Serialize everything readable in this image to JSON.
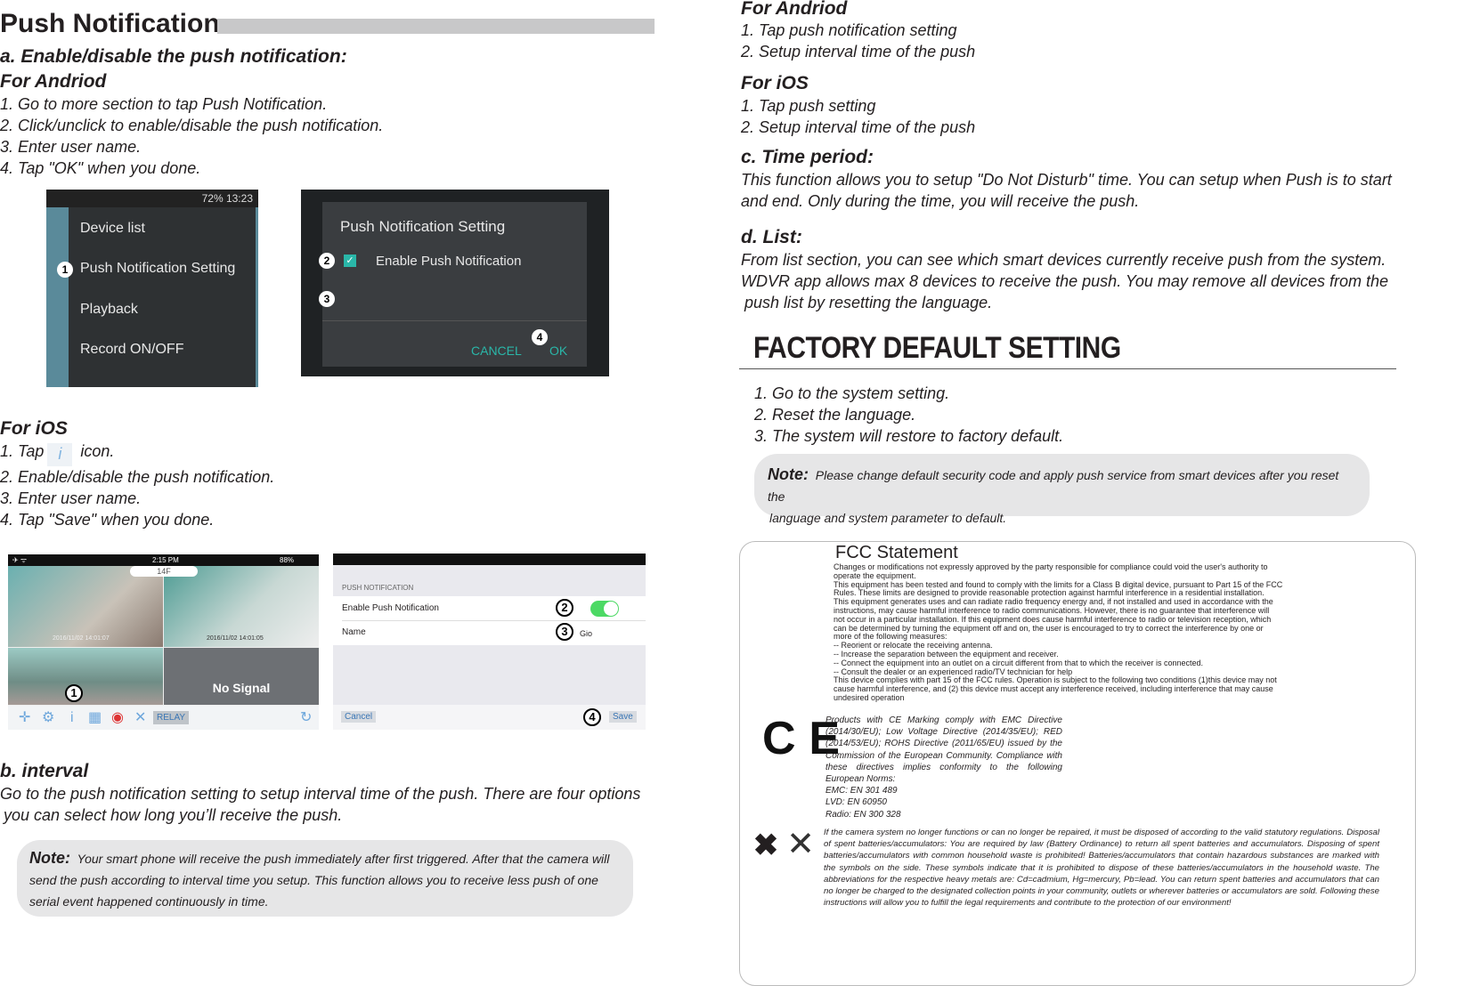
{
  "left": {
    "title": "Push  Notification",
    "section_a": "a. Enable/disable the push notification:",
    "android_heading": "For Andriod",
    "android_steps": [
      "1. Go to more section to tap Push Notification.",
      "2. Click/unclick to enable/disable the push notification.",
      "3. Enter user name.",
      "4. Tap \"OK\" when you done."
    ],
    "android_shot1": {
      "status": "72%  13:23",
      "items": [
        "Device list",
        "Push Notification Setting",
        "Playback",
        "Record ON/OFF"
      ],
      "badge": "1"
    },
    "android_shot2": {
      "title": "Push Notification Setting",
      "checkbox_label": "Enable Push Notification",
      "cancel": "CANCEL",
      "ok": "OK",
      "badges": [
        "2",
        "3",
        "4"
      ]
    },
    "ios_heading": "For iOS",
    "ios_steps": [
      "1. Tap",
      "icon.",
      "2. Enable/disable the push notification.",
      "3. Enter user name.",
      "4. Tap \"Save\" when you done."
    ],
    "ios_shot1": {
      "time": "2:15 PM",
      "battery": "88%",
      "floor": "14F",
      "stamp1": "2016/11/02 14:01:07",
      "stamp2": "2016/11/02 14:01:05",
      "no_signal": "No Signal",
      "relay": "RELAY",
      "badge": "1"
    },
    "ios_shot2": {
      "section": "PUSH NOTIFICATION",
      "enable_label": "Enable Push Notification",
      "toggle_on": true,
      "name_label": "Name",
      "name_value": "Gio",
      "cancel": "Cancel",
      "save": "Save",
      "badges": [
        "2",
        "3",
        "4"
      ]
    },
    "section_b": "b. interval",
    "interval_text": [
      "Go to the push notification setting to setup interval time of the push. There are four options",
      "you can select how long you’ll receive the push."
    ],
    "note_label": "Note:",
    "note_text": [
      "Your smart phone will receive the push immediately after first triggered. After that the camera will",
      "send the push according to interval time you setup. This function allows you to receive less push of one",
      "serial event happened continuously in time."
    ]
  },
  "right": {
    "android_heading": "For Andriod",
    "android_steps": [
      "1. Tap push notification setting",
      "2. Setup interval time of the push"
    ],
    "ios_heading": "For iOS",
    "ios_steps": [
      "1. Tap push setting",
      "2. Setup interval time of the push"
    ],
    "section_c": "c. Time period:",
    "c_text": [
      "This function allows you to setup \"Do Not Disturb\" time. You can setup when Push is to start",
      "and end. Only during the time,  you will receive the push."
    ],
    "section_d": "d. List:",
    "d_text": [
      "From list section, you can see which smart devices currently receive push from the system.",
      "WDVR app allows max 8 devices to receive the push. You may remove all devices from the",
      "push list by resetting the language."
    ],
    "factory_title": "FACTORY DEFAULT SETTING",
    "factory_steps": [
      "1. Go to the system setting.",
      "2. Reset the language.",
      "3. The system will restore to factory default."
    ],
    "note_label": "Note:",
    "note_text": [
      "Please change default security code and apply push service from smart devices after you reset the",
      "language and system parameter to default."
    ],
    "fcc_title": "FCC Statement",
    "fcc_lines": [
      "Changes or modifications not expressly approved by the party responsible for compliance could void the user's authority to",
      "operate the equipment.",
      "This equipment has been tested and found to comply with the limits for a Class B digital device, pursuant to Part 15 of the FCC",
      "Rules. These limits are designed to provide reasonable protection against harmful interference in a residential installation.",
      "This equipment generates uses and can radiate radio frequency energy and, if not installed and used in accordance with the",
      "instructions, may cause harmful interference to radio communications. However, there is no guarantee that interference will",
      "not occur in a particular installation. If this equipment does cause harmful interference to radio or television reception, which",
      "can be determined by turning the equipment off and on, the user is encouraged to try to correct the interference by one or",
      "more of the following measures:",
      "-- Reorient or relocate the receiving antenna.",
      "-- Increase the separation between the equipment and receiver.",
      "-- Connect the equipment into an outlet on a circuit different from that to which the receiver is connected.",
      "-- Consult the dealer or an experienced radio/TV technician for help",
      "This device complies with part 15 of the FCC rules. Operation is subject to the following two conditions (1)this device may not",
      "cause harmful interference, and (2) this device must accept any interference received, including interference that may cause",
      "undesired operation"
    ],
    "ce_logo": "CE",
    "ce_text": "Products with CE Marking comply with EMC Directive (2014/30/EU); Low Voltage Directive (2014/35/EU); RED (2014/53/EU); ROHS Directive (2011/65/EU) issued by the Commission of the European Community. Compliance with these directives implies conformity to the following European Norms:",
    "ce_norms": [
      "EMC: EN 301 489",
      "LVD: EN 60950",
      "Radio: EN 300 328"
    ],
    "disposal_text": "If the camera system no longer functions or can no longer be repaired, it must be disposed of according to the valid statutory regulations. Disposal of spent batteries/accumulators: You are required by law (Battery Ordinance) to return all spent batteries and accumulators. Disposing of spent batteries/accumulators with common household waste is prohibited!  Batteries/accumulators that contain hazardous substances are marked with the symbols on the side. These symbols indicate that it is prohibited to dispose of these batteries/accumulators in the household waste. The abbreviations for the respective heavy metals are: Cd=cadmium, Hg=mercury, Pb=lead. You can return spent batteries and accumulators that can no longer be charged to the designated collection points in your community, outlets or wherever batteries or accumulators are sold. Following these instructions will allow you to fulfill the legal requirements and contribute to the protection of our environment!"
  }
}
